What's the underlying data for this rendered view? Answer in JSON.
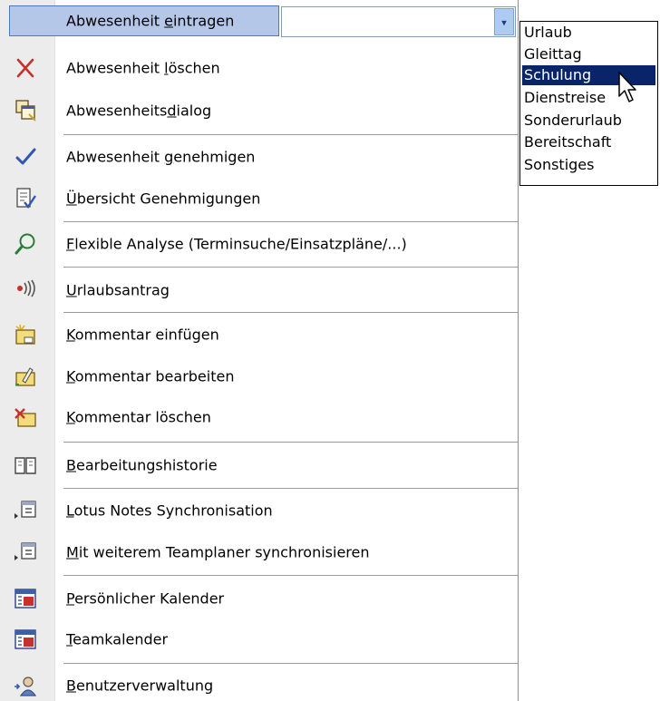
{
  "menu": {
    "combo_label_before": "Abwesenheit ",
    "combo_label_u": "e",
    "combo_label_after": "intragen",
    "combo_value": "",
    "combo_arrow": "▾",
    "items": [
      {
        "icon": "delete-x-icon",
        "pre": "Abwesenheit ",
        "u": "l",
        "post": "öschen"
      },
      {
        "icon": "dialog-window-icon",
        "pre": "Abwesenheits",
        "u": "d",
        "post": "ialog"
      },
      {
        "icon": "checkmark-icon",
        "pre": "Abwesenheit ",
        "u": "g",
        "post": "enehmigen"
      },
      {
        "icon": "approval-overview-icon",
        "pre": "",
        "u": "Ü",
        "post": "bersicht Genehmigungen"
      },
      {
        "icon": "magnifier-icon",
        "pre": "",
        "u": "F",
        "post": "lexible Analyse (Terminsuche/Einsatzpläne/...)"
      },
      {
        "icon": "vacation-request-icon",
        "pre": "",
        "u": "U",
        "post": "rlaubsantrag"
      },
      {
        "icon": "insert-comment-icon",
        "pre": "",
        "u": "K",
        "post": "ommentar einfügen"
      },
      {
        "icon": "edit-comment-icon",
        "pre": "",
        "u": "K",
        "post": "ommentar bearbeiten"
      },
      {
        "icon": "delete-comment-icon",
        "pre": "",
        "u": "K",
        "post": "ommentar löschen"
      },
      {
        "icon": "history-book-icon",
        "pre": "",
        "u": "B",
        "post": "earbeitungshistorie"
      },
      {
        "icon": "lotus-notes-sync-icon",
        "pre": "",
        "u": "L",
        "post": "otus Notes Synchronisation"
      },
      {
        "icon": "teamplaner-sync-icon",
        "pre": "",
        "u": "M",
        "post": "it weiterem Teamplaner synchronisieren"
      },
      {
        "icon": "personal-calendar-icon",
        "pre": "",
        "u": "P",
        "post": "ersönlicher Kalender"
      },
      {
        "icon": "team-calendar-icon",
        "pre": "",
        "u": "T",
        "post": "eamkalender"
      },
      {
        "icon": "user-admin-icon",
        "pre": "",
        "u": "B",
        "post": "enutzerverwaltung"
      }
    ]
  },
  "dropdown": {
    "options": [
      "Urlaub",
      "Gleittag",
      "Schulung",
      "Dienstreise",
      "Sonderurlaub",
      "Bereitschaft",
      "Sonstiges"
    ],
    "selected": "Schulung"
  },
  "colors": {
    "highlight": "#b5c7e9",
    "selection": "#0a246a",
    "gutter": "#ececec"
  }
}
